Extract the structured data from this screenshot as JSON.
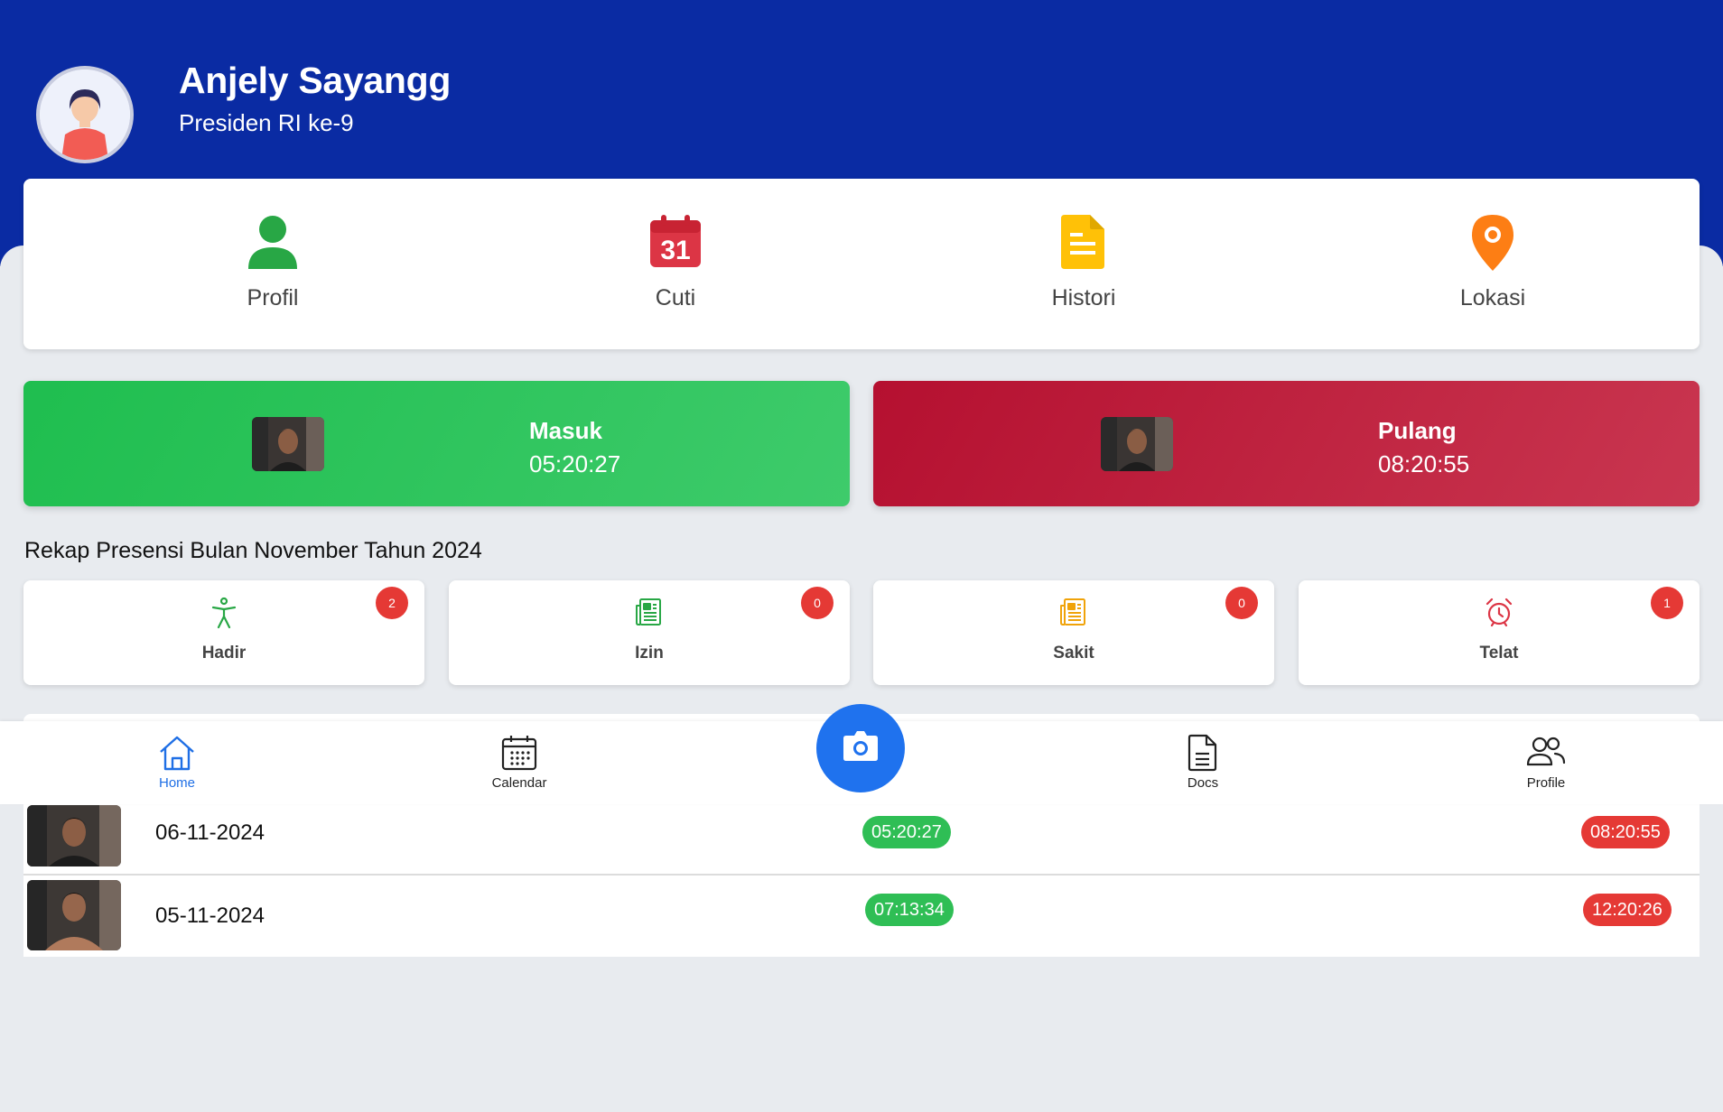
{
  "user": {
    "name": "Anjely Sayangg",
    "role": "Presiden RI ke-9"
  },
  "menu": [
    {
      "label": "Profil",
      "icon": "person-icon",
      "color": "#28a745"
    },
    {
      "label": "Cuti",
      "icon": "calendar-31-icon",
      "color": "#dc3545",
      "icon_text": "31"
    },
    {
      "label": "Histori",
      "icon": "document-icon",
      "color": "#ffc107"
    },
    {
      "label": "Lokasi",
      "icon": "location-pin-icon",
      "color": "#fd7e14"
    }
  ],
  "attendance": {
    "in": {
      "title": "Masuk",
      "time": "05:20:27",
      "color": "#1fbe4f"
    },
    "out": {
      "title": "Pulang",
      "time": "08:20:55",
      "color": "#b51030"
    }
  },
  "rekap": {
    "title": "Rekap Presensi Bulan November Tahun 2024",
    "items": [
      {
        "label": "Hadir",
        "count": "2",
        "icon": "accessibility-icon",
        "color": "#28a745"
      },
      {
        "label": "Izin",
        "count": "0",
        "icon": "newspaper-icon",
        "color": "#28a745"
      },
      {
        "label": "Sakit",
        "count": "0",
        "icon": "newspaper-icon",
        "color": "#f0a30a"
      },
      {
        "label": "Telat",
        "count": "1",
        "icon": "alarm-icon",
        "color": "#dc3545"
      }
    ]
  },
  "history": [
    {
      "date": "06-11-2024",
      "in": "05:20:27",
      "out": "08:20:55"
    },
    {
      "date": "05-11-2024",
      "in": "07:13:34",
      "out": "12:20:26"
    }
  ],
  "nav": {
    "home": "Home",
    "calendar": "Calendar",
    "docs": "Docs",
    "profile": "Profile",
    "active_color": "#1f6fe5",
    "fab_color": "#1f72ee"
  }
}
